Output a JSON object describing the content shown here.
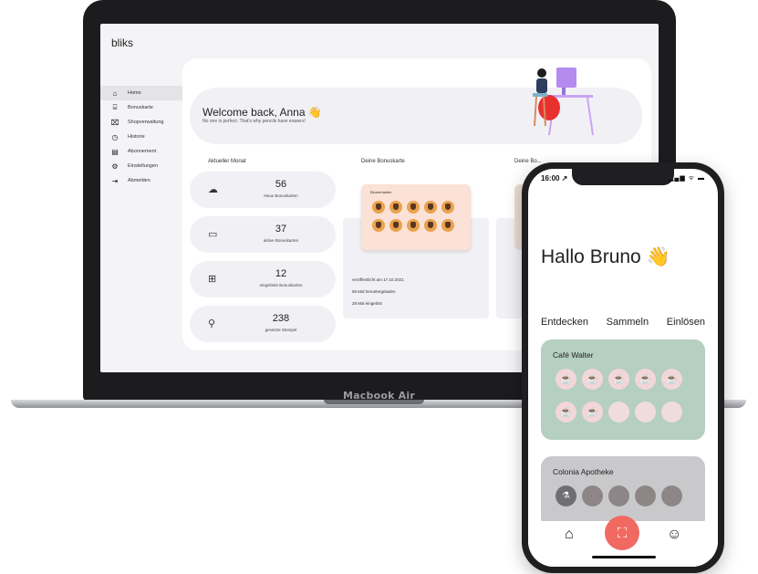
{
  "laptop": {
    "device_label": "Macbook Air",
    "brand": "bliks",
    "sidebar": [
      {
        "label": "Home",
        "icon": "home-icon",
        "glyph": "⌂",
        "active": true
      },
      {
        "label": "Bonuskarte",
        "icon": "bonuskarte-icon",
        "glyph": "⌸",
        "active": false
      },
      {
        "label": "Shopverwaltung",
        "icon": "shop-icon",
        "glyph": "⌧",
        "active": false
      },
      {
        "label": "Historie",
        "icon": "clock-icon",
        "glyph": "◷",
        "active": false
      },
      {
        "label": "Abonnement",
        "icon": "document-icon",
        "glyph": "▤",
        "active": false
      },
      {
        "label": "Einstellungen",
        "icon": "gear-icon",
        "glyph": "⚙",
        "active": false
      },
      {
        "label": "Abmelden",
        "icon": "logout-icon",
        "glyph": "⇥",
        "active": false
      }
    ],
    "welcome": {
      "title": "Welcome back, Anna 👋",
      "subtitle": "No one is perfect. That's why pencils have erasers!"
    },
    "sections": {
      "current_month": "Aktueller Monat",
      "your_card": "Deine Bonuskarte",
      "your_card_2": "Deine Bo..."
    },
    "stats": [
      {
        "value": "56",
        "label": "Neue Bonuskarten",
        "icon": "cloud-upload-icon",
        "glyph": "☁"
      },
      {
        "value": "37",
        "label": "aktive Bonuskarten",
        "icon": "card-icon",
        "glyph": "▭"
      },
      {
        "value": "12",
        "label": "eingelöste Bonuskarten",
        "icon": "gift-icon",
        "glyph": "🎁"
      },
      {
        "value": "238",
        "label": "gesetzte Stempel",
        "icon": "stamp-icon",
        "glyph": "⚲"
      }
    ],
    "bonus_card": {
      "title": "Blumenladen",
      "stamp_count": 10,
      "published": "veröffentlicht am 17.10.2021",
      "downloads": "56 Mal heruntergeladen",
      "redeemed": "28 Mal eingelöst"
    },
    "colors": {
      "card_peach": "#fbe1d6",
      "panel": "#f1f1f5"
    }
  },
  "phone": {
    "time": "16:00 ↗",
    "status_icons": "▂▄▆ ᯤ ▬",
    "greeting": "Hallo Bruno 👋",
    "tabs": [
      "Entdecken",
      "Sammeln",
      "Einlösen"
    ],
    "cards": [
      {
        "name": "Café Walter",
        "color": "#b5cfc1",
        "filled": 7,
        "total": 10,
        "stamp_icon": "coffee-cup-icon"
      },
      {
        "name": "Colonia Apotheke",
        "color": "#c9c9cb",
        "filled": 1,
        "total": 5,
        "stamp_icon": "mortar-icon"
      }
    ],
    "nav": {
      "home": "home-icon",
      "scan": "scan-icon",
      "profile": "profile-icon"
    },
    "colors": {
      "scan_button": "#f06a62"
    }
  }
}
